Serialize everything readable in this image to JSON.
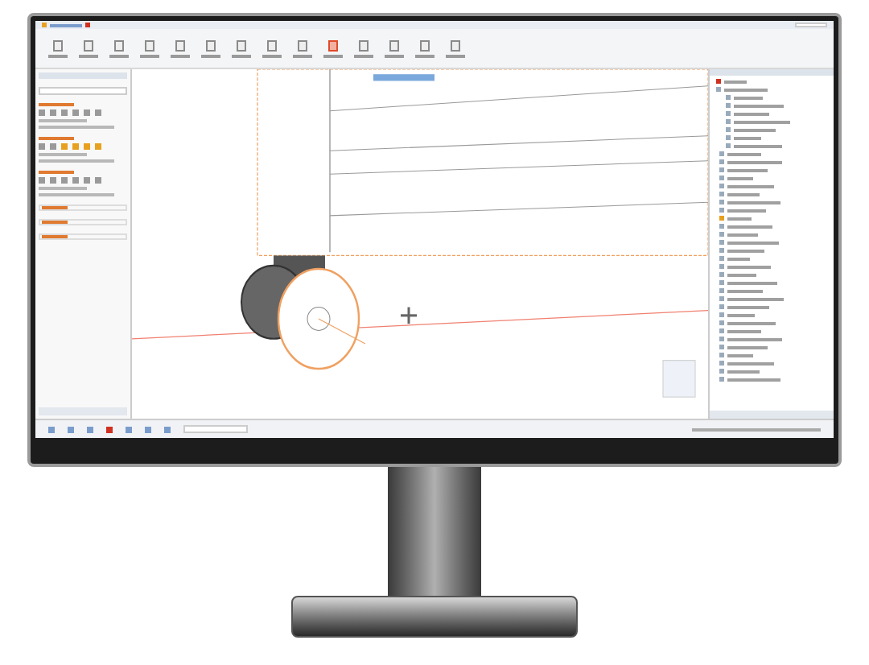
{
  "monitor": {
    "screen": {
      "kind": "cad-application"
    }
  }
}
